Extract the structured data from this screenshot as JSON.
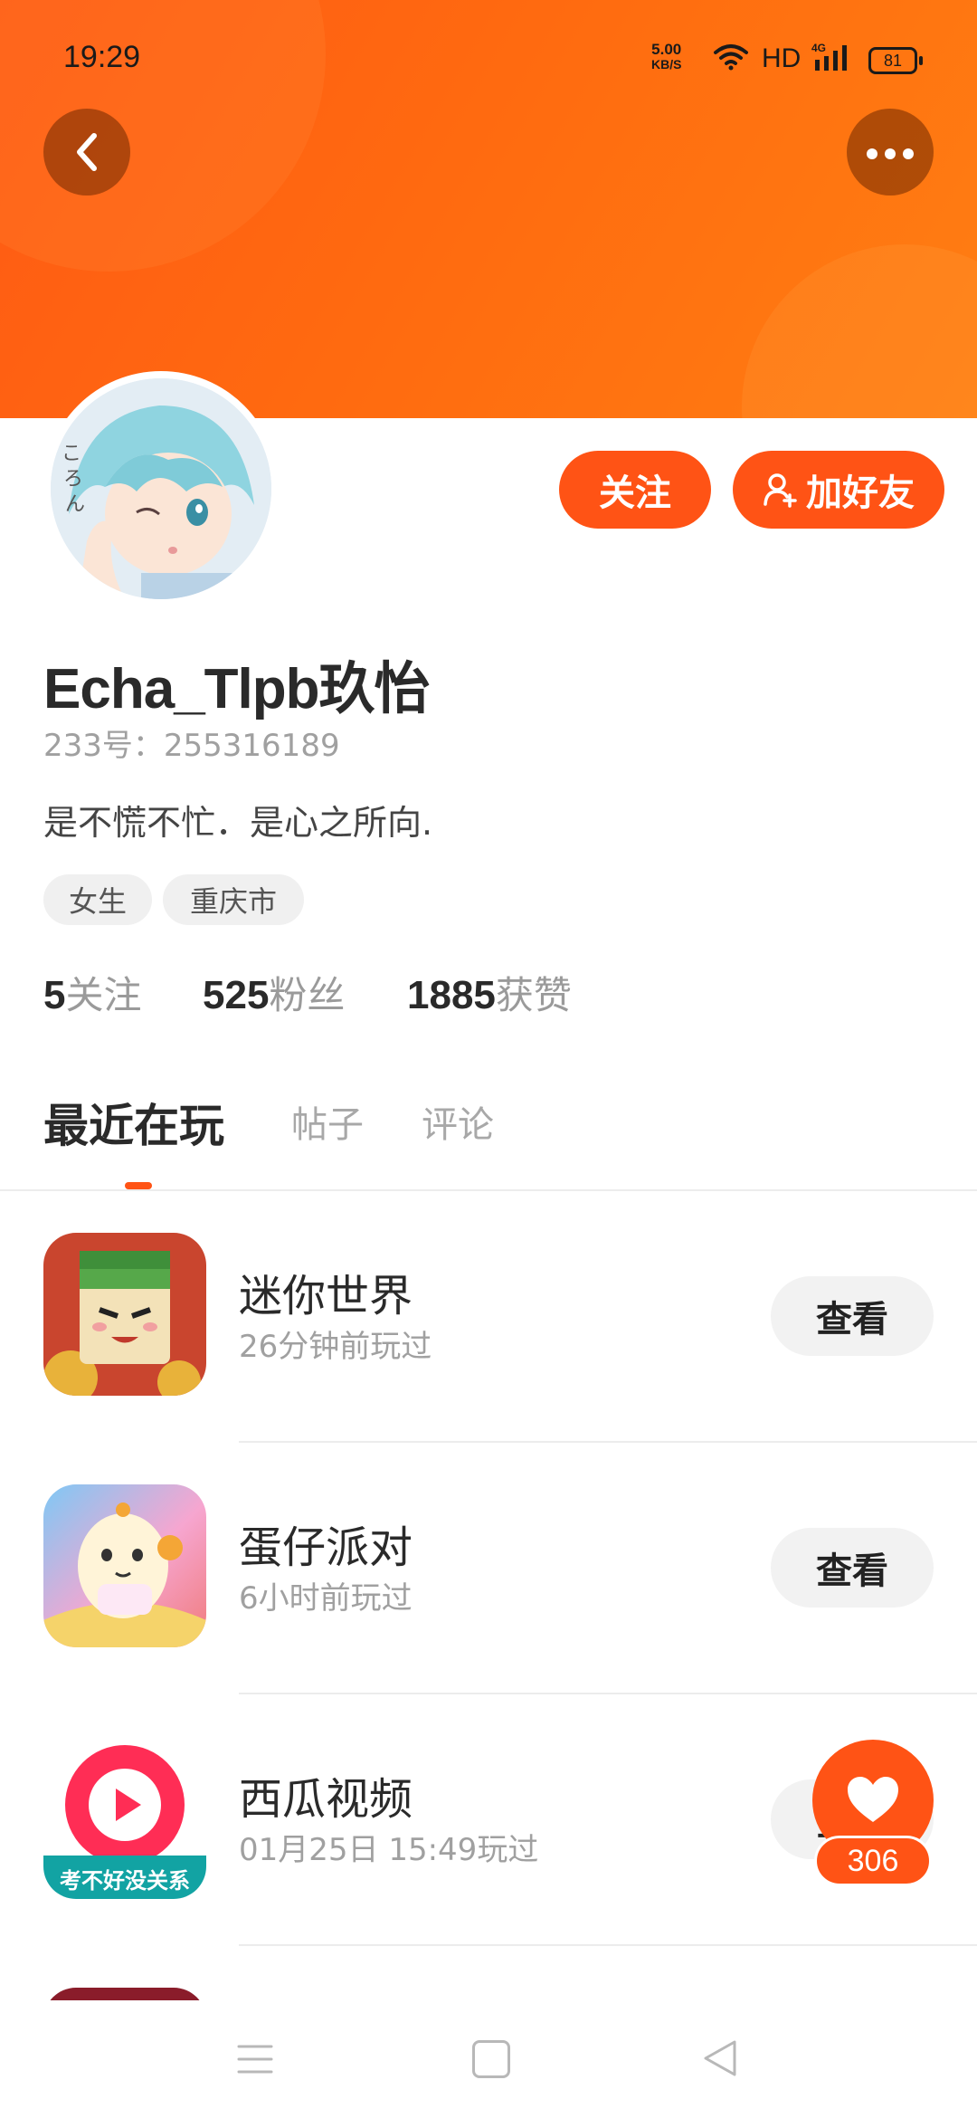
{
  "status_bar": {
    "time": "19:29",
    "net_speed": "5.00",
    "net_unit": "KB/S",
    "hd": "HD",
    "network": "4G",
    "battery": "81"
  },
  "header": {
    "back_icon": "chevron-left-icon",
    "more_icon": "more-horizontal-icon",
    "accent_color": "#ff5315"
  },
  "profile": {
    "nickname": "Echa_Tlpb玖怡",
    "uid": "233号：255316189",
    "bio": "是不慌不忙．是心之所向.",
    "tags": [
      "女生",
      "重庆市"
    ],
    "follow_label": "关注",
    "add_friend_label": "加好友",
    "stats": [
      {
        "num": "5",
        "label": "关注"
      },
      {
        "num": "525",
        "label": "粉丝"
      },
      {
        "num": "1885",
        "label": "获赞"
      }
    ]
  },
  "tabs": [
    "最近在玩",
    "帖子",
    "评论"
  ],
  "games": [
    {
      "name": "迷你世界",
      "time": "26分钟前玩过",
      "action": "查看"
    },
    {
      "name": "蛋仔派对",
      "time": "6小时前玩过",
      "action": "查看"
    },
    {
      "name": "西瓜视频",
      "time": "01月25日 15:49玩过",
      "action": "查看",
      "icon_text": "考不好没关系"
    }
  ],
  "float_like": {
    "count": "306",
    "icon": "heart-icon"
  },
  "nav": {
    "menu_icon": "menu-icon",
    "home_icon": "home-square-icon",
    "back_icon": "back-triangle-icon"
  }
}
